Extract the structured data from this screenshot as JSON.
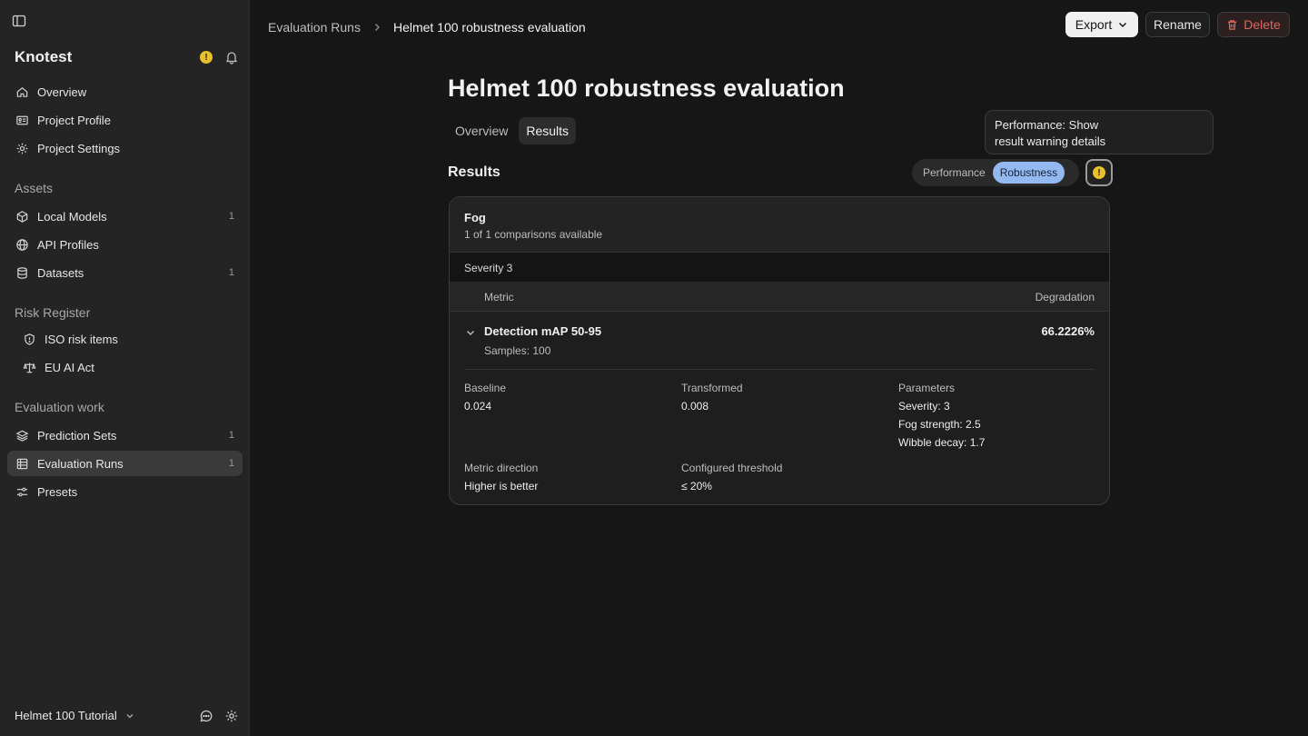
{
  "sidebar": {
    "brand": "Knotest",
    "warning_glyph": "!",
    "nav": [
      {
        "label": "Overview",
        "icon": "home-icon"
      },
      {
        "label": "Project Profile",
        "icon": "id-card-icon"
      },
      {
        "label": "Project Settings",
        "icon": "gear-icon"
      }
    ],
    "sections": {
      "assets": "Assets",
      "risk": "Risk Register",
      "evaluation": "Evaluation work"
    },
    "assets": [
      {
        "label": "Local Models",
        "count": "1",
        "icon": "cube-icon"
      },
      {
        "label": "API Profiles",
        "count": "",
        "icon": "globe-icon"
      },
      {
        "label": "Datasets",
        "count": "1",
        "icon": "database-icon"
      }
    ],
    "risk": [
      {
        "label": "ISO risk items",
        "icon": "shield-icon"
      },
      {
        "label": "EU AI Act",
        "icon": "scale-icon"
      }
    ],
    "evaluation": [
      {
        "label": "Prediction Sets",
        "count": "1",
        "icon": "layers-icon"
      },
      {
        "label": "Evaluation Runs",
        "count": "1",
        "icon": "table-icon",
        "active": true
      },
      {
        "label": "Presets",
        "count": "",
        "icon": "sliders-icon"
      }
    ],
    "workspace": "Helmet 100 Tutorial"
  },
  "topbar": {
    "breadcrumb_parent": "Evaluation Runs",
    "breadcrumb_current": "Helmet 100 robustness evaluation",
    "export_label": "Export",
    "rename_label": "Rename",
    "delete_label": "Delete"
  },
  "main": {
    "title": "Helmet 100 robustness evaluation",
    "tabs": [
      {
        "label": "Overview",
        "active": false
      },
      {
        "label": "Results",
        "active": true
      }
    ],
    "results_heading": "Results",
    "toggle": {
      "performance": "Performance",
      "robustness": "Robustness",
      "selected": "Robustness"
    },
    "tooltip_line1": "Performance: Show",
    "tooltip_line2": "result warning details",
    "accent_color": "#93b9f0",
    "warning_color": "#e8c02b",
    "danger_color": "#e2675e"
  },
  "card": {
    "title": "Fog",
    "subtitle": "1 of 1 comparisons available",
    "severity": "Severity 3",
    "col_metric": "Metric",
    "col_degradation": "Degradation",
    "metric_name": "Detection mAP 50-95",
    "metric_samples": "Samples: 100",
    "degradation": "66.2226%",
    "baseline_label": "Baseline",
    "baseline_value": "0.024",
    "transformed_label": "Transformed",
    "transformed_value": "0.008",
    "parameters_label": "Parameters",
    "params": [
      "Severity: 3",
      "Fog strength: 2.5",
      "Wibble decay: 1.7"
    ],
    "direction_label": "Metric direction",
    "direction_value": "Higher is better",
    "threshold_label": "Configured threshold",
    "threshold_value": "≤ 20%"
  }
}
